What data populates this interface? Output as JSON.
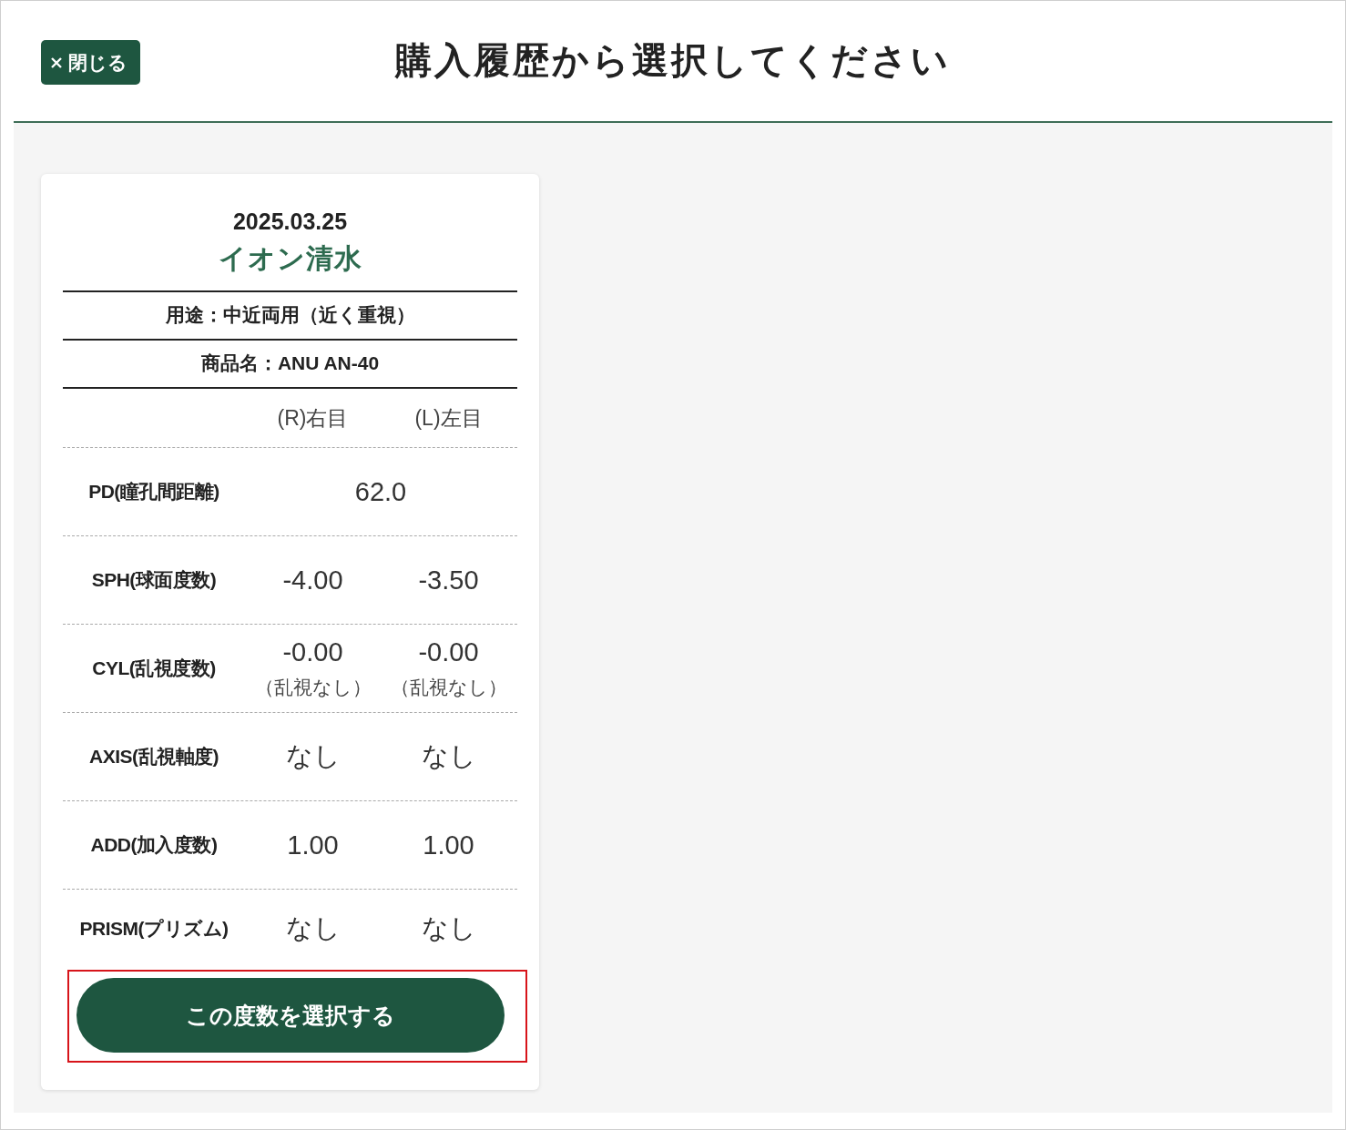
{
  "close_button": {
    "label": "閉じる"
  },
  "title": "購入履歴から選択してください",
  "records": [
    {
      "date": "2025.03.25",
      "store": "イオン清水",
      "purpose": "用途：中近両用（近く重視）",
      "product": "商品名：ANU AN-40",
      "columns": [
        "(R)右目",
        "(L)左目"
      ],
      "rows": [
        {
          "label": "PD(瞳孔間距離)",
          "values": [
            "62.0"
          ]
        },
        {
          "label": "SPH(球面度数)",
          "values": [
            "-4.00",
            "-3.50"
          ]
        },
        {
          "label": "CYL(乱視度数)",
          "values": [
            "-0.00",
            "-0.00"
          ],
          "notes": [
            "（乱視なし）",
            "（乱視なし）"
          ]
        },
        {
          "label": "AXIS(乱視軸度)",
          "values": [
            "なし",
            "なし"
          ]
        },
        {
          "label": "ADD(加入度数)",
          "values": [
            "1.00",
            "1.00"
          ]
        },
        {
          "label": "PRISM(プリズム)",
          "values": [
            "なし",
            "なし"
          ]
        }
      ],
      "button": {
        "label": "この度数を選択する",
        "highlighted": true
      }
    }
  ]
}
